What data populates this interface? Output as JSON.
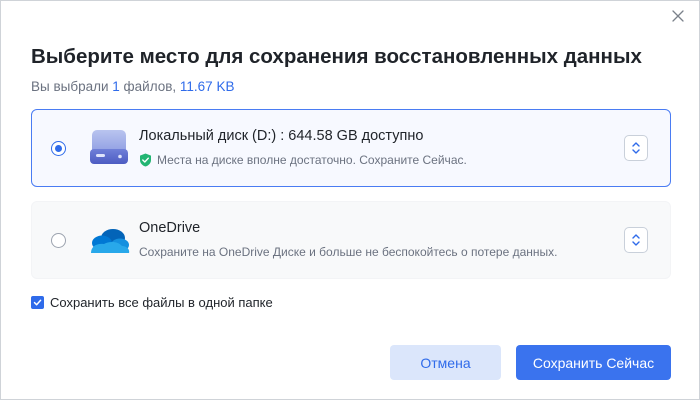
{
  "dialog": {
    "title": "Выберите место для сохранения восстановленных данных",
    "subtitle": {
      "prefix": "Вы выбрали ",
      "count": "1",
      "middle": " файлов, ",
      "size": "11.67 KB"
    }
  },
  "options": {
    "local": {
      "title": "Локальный диск (D:) : 644.58 GB доступно",
      "desc": "Места на диске вполне достаточно. Сохраните Сейчас.",
      "selected": true
    },
    "onedrive": {
      "title": "OneDrive",
      "desc": "Сохраните на OneDrive Диске и больше не беспокойтесь о потере данных.",
      "selected": false
    }
  },
  "same_folder": {
    "label": "Сохранить все файлы в одной папке",
    "checked": true
  },
  "buttons": {
    "cancel": "Отмена",
    "save": "Сохранить Сейчас"
  },
  "icons": {
    "close": "close-icon",
    "local": "hard-drive-icon",
    "onedrive": "onedrive-cloud-icon",
    "shield": "shield-check-icon",
    "stepper": "chevron-up-down-icon"
  },
  "colors": {
    "accent": "#2f6bea",
    "success": "#22b573",
    "cancel_bg": "#dbe6fb"
  }
}
